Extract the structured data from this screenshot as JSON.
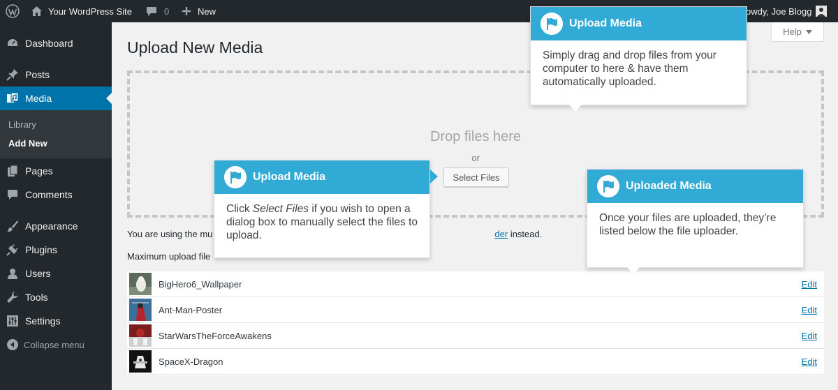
{
  "adminbar": {
    "site_name": "Your WordPress Site",
    "comments_count": "0",
    "new_label": "New",
    "howdy": "owdy, Joe Blogg"
  },
  "sidebar": {
    "items": [
      {
        "label": "Dashboard",
        "icon": "dashboard-icon"
      },
      {
        "label": "Posts",
        "icon": "pushpin-icon"
      },
      {
        "label": "Media",
        "icon": "media-icon"
      },
      {
        "label": "Pages",
        "icon": "pages-icon"
      },
      {
        "label": "Comments",
        "icon": "comment-icon"
      },
      {
        "label": "Appearance",
        "icon": "paintbrush-icon"
      },
      {
        "label": "Plugins",
        "icon": "plug-icon"
      },
      {
        "label": "Users",
        "icon": "user-icon"
      },
      {
        "label": "Tools",
        "icon": "wrench-icon"
      },
      {
        "label": "Settings",
        "icon": "settings-sliders-icon"
      }
    ],
    "submenu": [
      "Library",
      "Add New"
    ],
    "collapse_label": "Collapse menu"
  },
  "help_label": "Help",
  "page_title": "Upload New Media",
  "uploader": {
    "drop_text": "Drop files here",
    "or_text": "or",
    "select_files": "Select Files"
  },
  "upload_note": {
    "prefix": "You are using the mu",
    "link": "der",
    "suffix": " instead."
  },
  "max_size_text": "Maximum upload file",
  "media_items": [
    {
      "name": "BigHero6_Wallpaper",
      "edit": "Edit"
    },
    {
      "name": "Ant-Man-Poster",
      "edit": "Edit"
    },
    {
      "name": "StarWarsTheForceAwakens",
      "edit": "Edit"
    },
    {
      "name": "SpaceX-Dragon",
      "edit": "Edit"
    }
  ],
  "pointers": {
    "top": {
      "title": "Upload Media",
      "body": "Simply drag and drop files from your computer to here & have them automatically uploaded."
    },
    "left": {
      "title": "Upload Media",
      "body_pre": "Click ",
      "body_em": "Select Files",
      "body_post": " if you wish to open a dialog box to manually select the files to upload."
    },
    "right": {
      "title": "Uploaded Media",
      "body": "Once your files are uploaded, they’re listed below the file uploader."
    }
  },
  "colors": {
    "adminbar": "#23282d",
    "accent": "#0073aa",
    "pointer_header": "#32aad6"
  }
}
